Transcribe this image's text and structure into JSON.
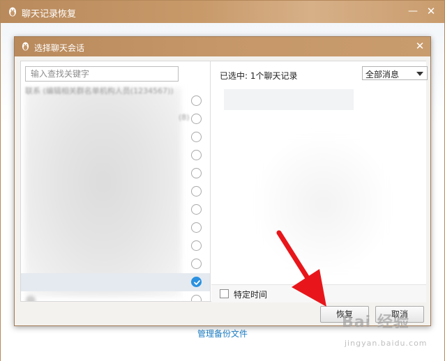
{
  "outer": {
    "title": "聊天记录恢复",
    "minimize_glyph": "—",
    "close_glyph": "✕",
    "manage_link": "管理备份文件"
  },
  "dialog": {
    "title": "选择聊天会话",
    "close_glyph": "✕",
    "search": {
      "placeholder": "输入查找关键字",
      "value": ""
    },
    "list": {
      "clipped_text_a": "联系 (编辑相关群名单机构人员(1234567))",
      "clipped_text_b": "(8)",
      "rows": [
        {
          "checked": false
        },
        {
          "checked": false
        },
        {
          "checked": false
        },
        {
          "checked": false
        },
        {
          "checked": false
        },
        {
          "checked": false
        },
        {
          "checked": false
        },
        {
          "checked": false
        },
        {
          "checked": false
        },
        {
          "checked": false
        },
        {
          "checked": true
        },
        {
          "checked": false
        }
      ]
    },
    "right": {
      "selected_count": "已选中: 1个聊天记录",
      "filter_value": "全部消息",
      "specific_time_label": "特定时间",
      "specific_time_checked": false
    },
    "buttons": {
      "restore": "恢复",
      "cancel": "取消"
    }
  },
  "watermark": {
    "main": "Bai 经验",
    "sub": "jingyan.baidu.com"
  },
  "colors": {
    "titlebar": "#c49668",
    "link": "#1d7fc6",
    "check_blue": "#2b91e0",
    "arrow_red": "#e8161a"
  },
  "icons": [
    "penguin-icon",
    "minimize-icon",
    "close-icon",
    "chevron-down-icon",
    "checkmark-icon",
    "red-arrow-annotation"
  ]
}
